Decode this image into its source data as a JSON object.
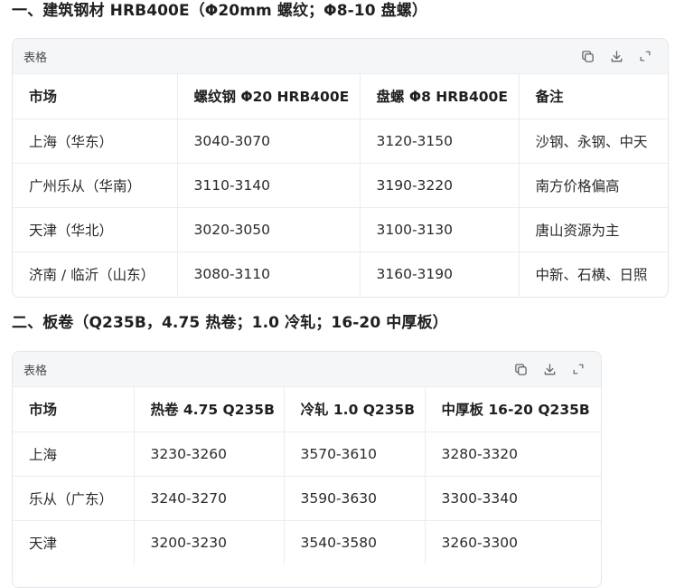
{
  "section1": {
    "heading": "一、建筑钢材 HRB400E（Φ20mm 螺纹；Φ8-10 盘螺）",
    "card_title": "表格",
    "headers": [
      "市场",
      "螺纹钢 Φ20 HRB400E",
      "盘螺 Φ8 HRB400E",
      "备注"
    ],
    "rows": [
      [
        "上海（华东）",
        "3040-3070",
        "3120-3150",
        "沙钢、永钢、中天"
      ],
      [
        "广州乐从（华南）",
        "3110-3140",
        "3190-3220",
        "南方价格偏高"
      ],
      [
        "天津（华北）",
        "3020-3050",
        "3100-3130",
        "唐山资源为主"
      ],
      [
        "济南 / 临沂（山东）",
        "3080-3110",
        "3160-3190",
        "中新、石横、日照"
      ]
    ]
  },
  "section2": {
    "heading": "二、板卷（Q235B，4.75 热卷；1.0 冷轧；16-20 中厚板）",
    "card_title": "表格",
    "headers": [
      "市场",
      "热卷 4.75 Q235B",
      "冷轧 1.0 Q235B",
      "中厚板 16-20 Q235B"
    ],
    "rows": [
      [
        "上海",
        "3230-3260",
        "3570-3610",
        "3280-3320"
      ],
      [
        "乐从（广东）",
        "3240-3270",
        "3590-3630",
        "3300-3340"
      ],
      [
        "天津",
        "3200-3230",
        "3540-3580",
        "3260-3300"
      ]
    ]
  },
  "icons": {
    "copy": "copy-icon",
    "download": "download-icon",
    "expand": "expand-icon"
  }
}
